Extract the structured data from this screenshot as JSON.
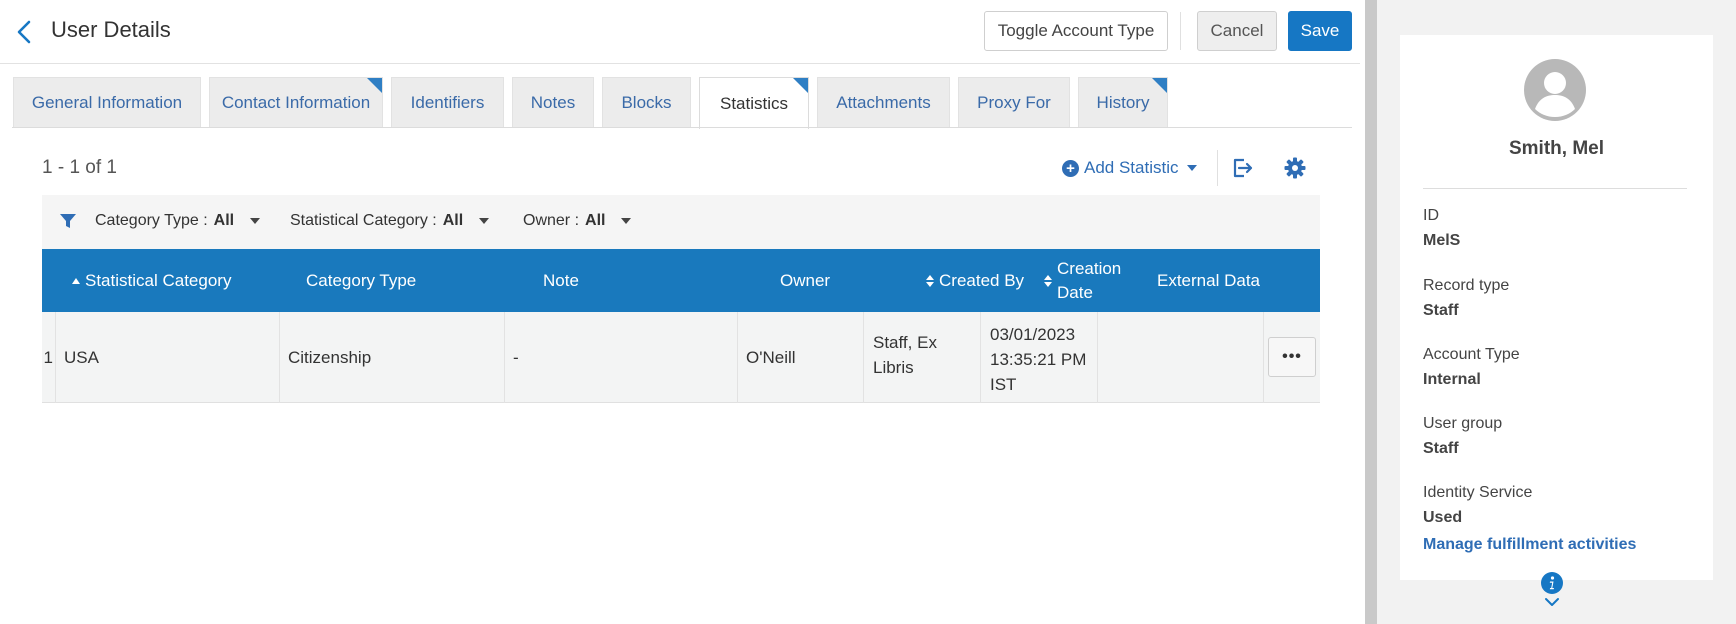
{
  "header": {
    "title": "User Details",
    "toggle_label": "Toggle Account Type",
    "cancel_label": "Cancel",
    "save_label": "Save"
  },
  "tabs": [
    {
      "label": "General Information",
      "active": false,
      "flag": false
    },
    {
      "label": "Contact Information",
      "active": false,
      "flag": true
    },
    {
      "label": "Identifiers",
      "active": false,
      "flag": false
    },
    {
      "label": "Notes",
      "active": false,
      "flag": false
    },
    {
      "label": "Blocks",
      "active": false,
      "flag": false
    },
    {
      "label": "Statistics",
      "active": true,
      "flag": true
    },
    {
      "label": "Attachments",
      "active": false,
      "flag": false
    },
    {
      "label": "Proxy For",
      "active": false,
      "flag": false
    },
    {
      "label": "History",
      "active": false,
      "flag": true
    }
  ],
  "toolbar": {
    "counter": "1 - 1 of 1",
    "add_label": "Add Statistic"
  },
  "filters": [
    {
      "label": "Category Type :",
      "value": "All"
    },
    {
      "label": "Statistical Category :",
      "value": "All"
    },
    {
      "label": "Owner :",
      "value": "All"
    }
  ],
  "table": {
    "columns": {
      "stat_category": "Statistical Category",
      "category_type": "Category Type",
      "note": "Note",
      "owner": "Owner",
      "created_by": "Created By",
      "creation_date_1": "Creation",
      "creation_date_2": "Date",
      "external_data": "External Data"
    },
    "rows": [
      {
        "num": "1",
        "stat_category": "USA",
        "category_type": "Citizenship",
        "note": "-",
        "owner": "O'Neill",
        "created_by_1": "Staff, Ex",
        "created_by_2": "Libris",
        "date_1": "03/01/2023",
        "date_2": "13:35:21 PM",
        "date_3": "IST",
        "external_data": "",
        "actions": "•••"
      }
    ]
  },
  "panel": {
    "name": "Smith, Mel",
    "fields": [
      {
        "label": "ID",
        "value": "MelS"
      },
      {
        "label": "Record type",
        "value": "Staff"
      },
      {
        "label": "Account Type",
        "value": "Internal"
      },
      {
        "label": "User group",
        "value": "Staff"
      },
      {
        "label": "Identity Service",
        "value": "Used"
      }
    ],
    "link": "Manage fulfillment activities"
  },
  "colors": {
    "accent": "#1677c4",
    "table_header": "#1979bd",
    "link": "#2f6db5"
  }
}
